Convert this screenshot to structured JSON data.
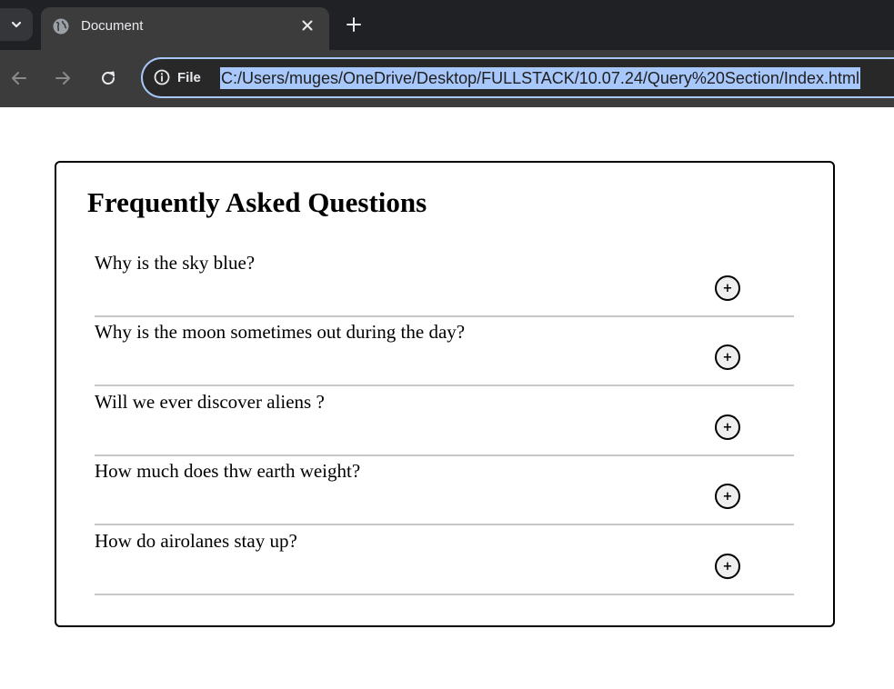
{
  "browser": {
    "tab": {
      "title": "Document",
      "favicon": "globe-icon"
    },
    "new_tab_icon": "plus-icon",
    "close_icon": "close-icon",
    "omnibox": {
      "site_info_label": "File",
      "url": "C:/Users/muges/OneDrive/Desktop/FULLSTACK/10.07.24/Query%20Section/Index.html"
    }
  },
  "page": {
    "title": "Frequently Asked Questions",
    "toggle_symbol": "+",
    "questions": [
      {
        "text": "Why is the sky blue?"
      },
      {
        "text": "Why is the moon sometimes out during the day?"
      },
      {
        "text": "Will we ever discover aliens ?"
      },
      {
        "text": "How much does thw earth weight?"
      },
      {
        "text": "How do airolanes stay up?"
      }
    ]
  },
  "colors": {
    "chrome_dark": "#202124",
    "chrome_toolbar": "#3c3c3c",
    "url_highlight": "#a8c7fa",
    "divider": "#c8c8c8"
  }
}
